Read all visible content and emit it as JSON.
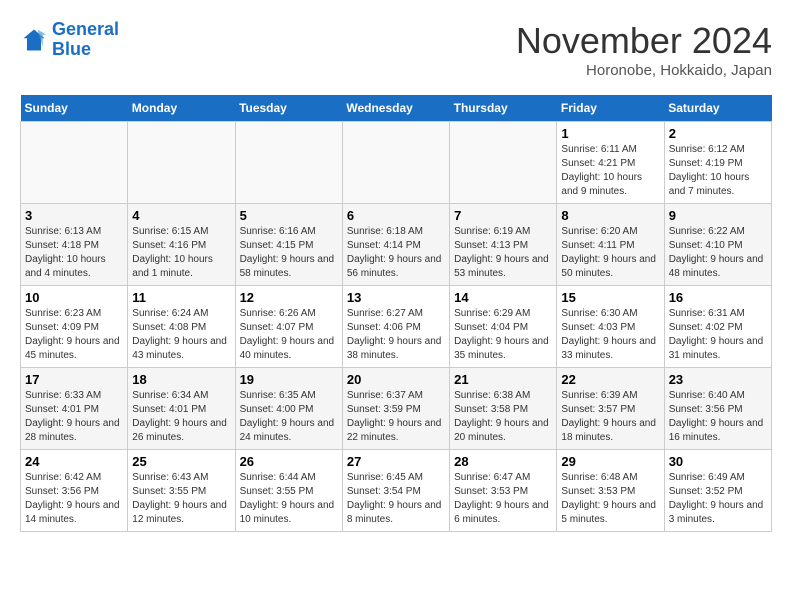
{
  "logo": {
    "line1": "General",
    "line2": "Blue"
  },
  "title": "November 2024",
  "location": "Horonobe, Hokkaido, Japan",
  "weekdays": [
    "Sunday",
    "Monday",
    "Tuesday",
    "Wednesday",
    "Thursday",
    "Friday",
    "Saturday"
  ],
  "weeks": [
    [
      {
        "day": "",
        "info": ""
      },
      {
        "day": "",
        "info": ""
      },
      {
        "day": "",
        "info": ""
      },
      {
        "day": "",
        "info": ""
      },
      {
        "day": "",
        "info": ""
      },
      {
        "day": "1",
        "info": "Sunrise: 6:11 AM\nSunset: 4:21 PM\nDaylight: 10 hours and 9 minutes."
      },
      {
        "day": "2",
        "info": "Sunrise: 6:12 AM\nSunset: 4:19 PM\nDaylight: 10 hours and 7 minutes."
      }
    ],
    [
      {
        "day": "3",
        "info": "Sunrise: 6:13 AM\nSunset: 4:18 PM\nDaylight: 10 hours and 4 minutes."
      },
      {
        "day": "4",
        "info": "Sunrise: 6:15 AM\nSunset: 4:16 PM\nDaylight: 10 hours and 1 minute."
      },
      {
        "day": "5",
        "info": "Sunrise: 6:16 AM\nSunset: 4:15 PM\nDaylight: 9 hours and 58 minutes."
      },
      {
        "day": "6",
        "info": "Sunrise: 6:18 AM\nSunset: 4:14 PM\nDaylight: 9 hours and 56 minutes."
      },
      {
        "day": "7",
        "info": "Sunrise: 6:19 AM\nSunset: 4:13 PM\nDaylight: 9 hours and 53 minutes."
      },
      {
        "day": "8",
        "info": "Sunrise: 6:20 AM\nSunset: 4:11 PM\nDaylight: 9 hours and 50 minutes."
      },
      {
        "day": "9",
        "info": "Sunrise: 6:22 AM\nSunset: 4:10 PM\nDaylight: 9 hours and 48 minutes."
      }
    ],
    [
      {
        "day": "10",
        "info": "Sunrise: 6:23 AM\nSunset: 4:09 PM\nDaylight: 9 hours and 45 minutes."
      },
      {
        "day": "11",
        "info": "Sunrise: 6:24 AM\nSunset: 4:08 PM\nDaylight: 9 hours and 43 minutes."
      },
      {
        "day": "12",
        "info": "Sunrise: 6:26 AM\nSunset: 4:07 PM\nDaylight: 9 hours and 40 minutes."
      },
      {
        "day": "13",
        "info": "Sunrise: 6:27 AM\nSunset: 4:06 PM\nDaylight: 9 hours and 38 minutes."
      },
      {
        "day": "14",
        "info": "Sunrise: 6:29 AM\nSunset: 4:04 PM\nDaylight: 9 hours and 35 minutes."
      },
      {
        "day": "15",
        "info": "Sunrise: 6:30 AM\nSunset: 4:03 PM\nDaylight: 9 hours and 33 minutes."
      },
      {
        "day": "16",
        "info": "Sunrise: 6:31 AM\nSunset: 4:02 PM\nDaylight: 9 hours and 31 minutes."
      }
    ],
    [
      {
        "day": "17",
        "info": "Sunrise: 6:33 AM\nSunset: 4:01 PM\nDaylight: 9 hours and 28 minutes."
      },
      {
        "day": "18",
        "info": "Sunrise: 6:34 AM\nSunset: 4:01 PM\nDaylight: 9 hours and 26 minutes."
      },
      {
        "day": "19",
        "info": "Sunrise: 6:35 AM\nSunset: 4:00 PM\nDaylight: 9 hours and 24 minutes."
      },
      {
        "day": "20",
        "info": "Sunrise: 6:37 AM\nSunset: 3:59 PM\nDaylight: 9 hours and 22 minutes."
      },
      {
        "day": "21",
        "info": "Sunrise: 6:38 AM\nSunset: 3:58 PM\nDaylight: 9 hours and 20 minutes."
      },
      {
        "day": "22",
        "info": "Sunrise: 6:39 AM\nSunset: 3:57 PM\nDaylight: 9 hours and 18 minutes."
      },
      {
        "day": "23",
        "info": "Sunrise: 6:40 AM\nSunset: 3:56 PM\nDaylight: 9 hours and 16 minutes."
      }
    ],
    [
      {
        "day": "24",
        "info": "Sunrise: 6:42 AM\nSunset: 3:56 PM\nDaylight: 9 hours and 14 minutes."
      },
      {
        "day": "25",
        "info": "Sunrise: 6:43 AM\nSunset: 3:55 PM\nDaylight: 9 hours and 12 minutes."
      },
      {
        "day": "26",
        "info": "Sunrise: 6:44 AM\nSunset: 3:55 PM\nDaylight: 9 hours and 10 minutes."
      },
      {
        "day": "27",
        "info": "Sunrise: 6:45 AM\nSunset: 3:54 PM\nDaylight: 9 hours and 8 minutes."
      },
      {
        "day": "28",
        "info": "Sunrise: 6:47 AM\nSunset: 3:53 PM\nDaylight: 9 hours and 6 minutes."
      },
      {
        "day": "29",
        "info": "Sunrise: 6:48 AM\nSunset: 3:53 PM\nDaylight: 9 hours and 5 minutes."
      },
      {
        "day": "30",
        "info": "Sunrise: 6:49 AM\nSunset: 3:52 PM\nDaylight: 9 hours and 3 minutes."
      }
    ]
  ]
}
